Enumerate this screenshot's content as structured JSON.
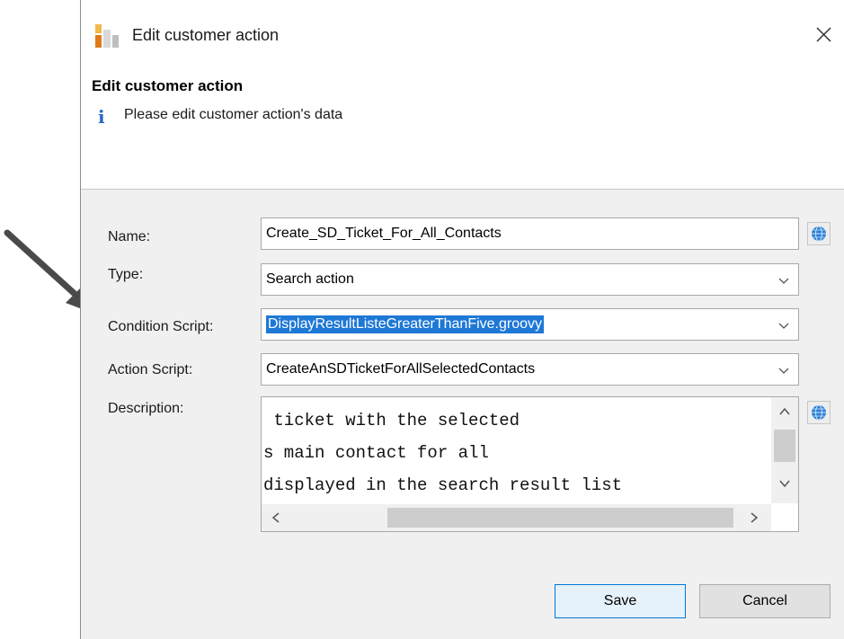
{
  "window": {
    "title": "Edit customer action",
    "close_icon": "close-icon"
  },
  "header": {
    "title": "Edit customer action",
    "info_glyph": "i",
    "message": "Please edit customer action's data"
  },
  "form": {
    "name": {
      "label": "Name:",
      "value": "Create_SD_Ticket_For_All_Contacts"
    },
    "type": {
      "label": "Type:",
      "value": "Search action"
    },
    "condition_script": {
      "label": "Condition Script:",
      "value": "DisplayResultListeGreaterThanFive.groovy"
    },
    "action_script": {
      "label": "Action Script:",
      "value": "CreateAnSDTicketForAllSelectedContacts"
    },
    "description": {
      "label": "Description:",
      "lines": [
        " ticket with the selected",
        "s main contact for all",
        "displayed in the search result list"
      ]
    }
  },
  "buttons": {
    "save": "Save",
    "cancel": "Cancel"
  },
  "colors": {
    "selection": "#1e78d6",
    "globe": "#2a7fd4",
    "info": "#2a66c8"
  }
}
